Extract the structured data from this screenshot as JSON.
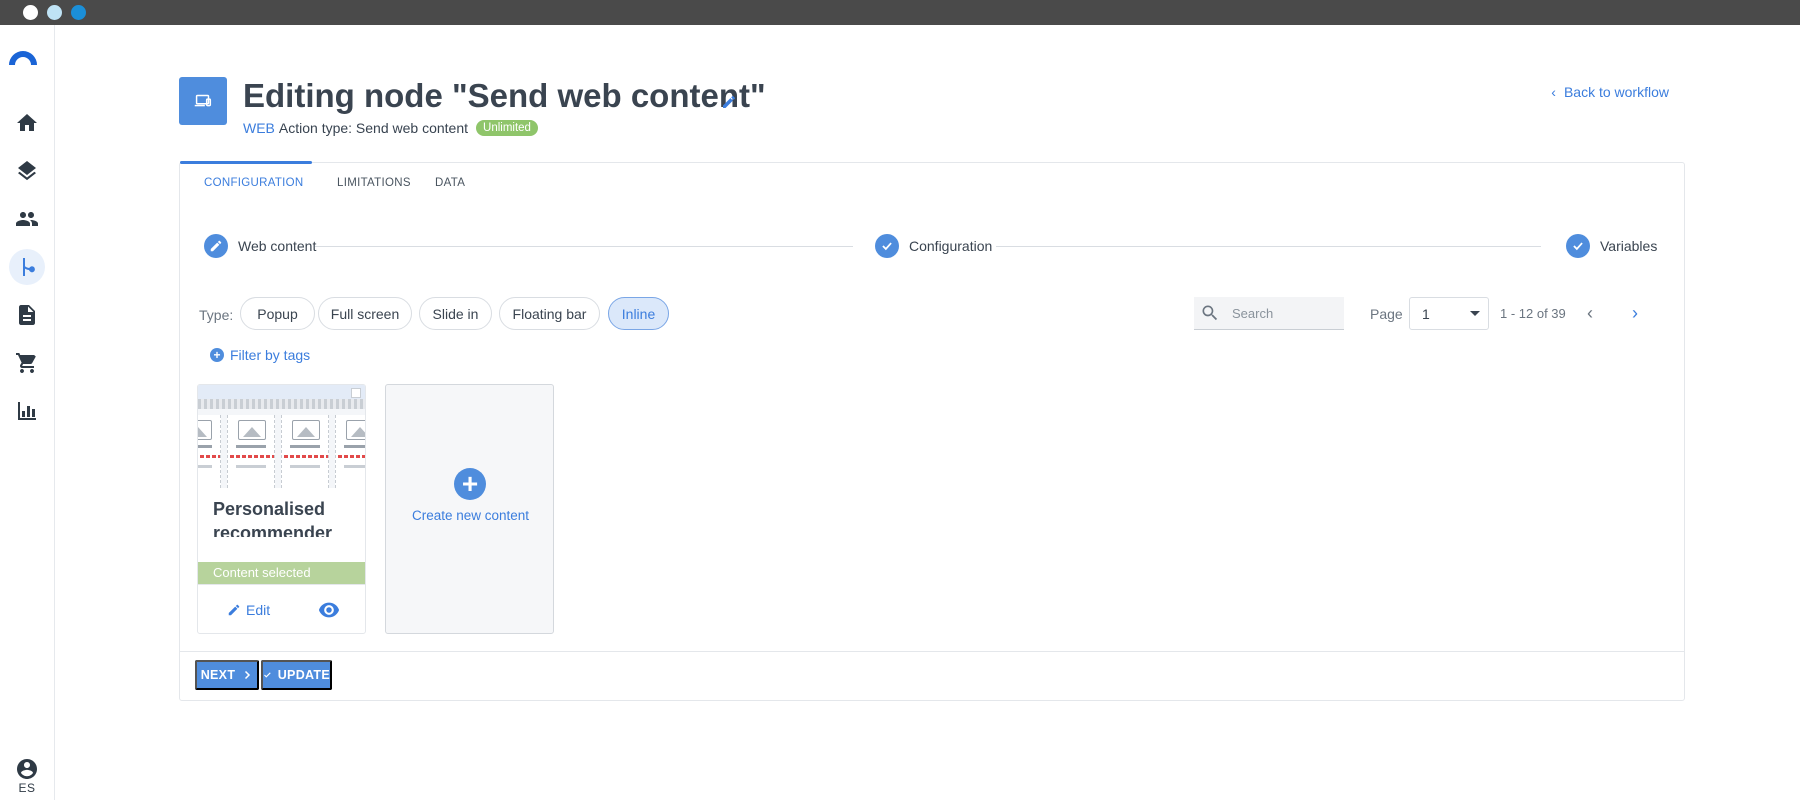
{
  "window": {
    "controls": [
      "close",
      "minimize",
      "maximize"
    ]
  },
  "sidebar": {
    "items": [
      {
        "icon": "home-icon"
      },
      {
        "icon": "layers-icon"
      },
      {
        "icon": "people-icon"
      },
      {
        "icon": "workflow-icon",
        "active": true
      },
      {
        "icon": "document-icon"
      },
      {
        "icon": "cart-icon"
      },
      {
        "icon": "bar-chart-icon"
      }
    ],
    "user_initials": "ES"
  },
  "header": {
    "title": "Editing node \"Send web content\"",
    "channel": "WEB",
    "action_type": "Action type: Send web content",
    "badge": "Unlimited",
    "back_link": "Back to workflow"
  },
  "tabs": [
    {
      "label": "CONFIGURATION",
      "active": true
    },
    {
      "label": "LIMITATIONS"
    },
    {
      "label": "DATA"
    }
  ],
  "stepper": [
    {
      "label": "Web content",
      "state": "edit"
    },
    {
      "label": "Configuration",
      "state": "done"
    },
    {
      "label": "Variables",
      "state": "done"
    }
  ],
  "type_filter": {
    "label": "Type:",
    "options": [
      "Popup",
      "Full screen",
      "Slide in",
      "Floating bar",
      "Inline"
    ],
    "selected": "Inline"
  },
  "filter_by_tags": "Filter by tags",
  "search": {
    "placeholder": "Search",
    "value": ""
  },
  "pagination": {
    "label": "Page",
    "current": "1",
    "range": "1 - 12 of 39"
  },
  "content_items": [
    {
      "title": "Personalised recommender",
      "status": "Content selected",
      "edit_label": "Edit"
    }
  ],
  "create_label": "Create new content",
  "footer": {
    "next_label": "NEXT",
    "update_label": "UPDATE"
  },
  "colors": {
    "accent": "#3b7ddd",
    "badge": "#8fc56a",
    "selected": "#b7d39c"
  }
}
